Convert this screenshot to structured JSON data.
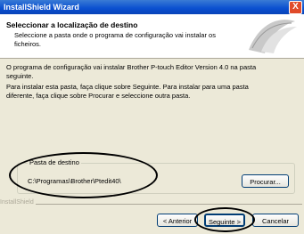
{
  "window": {
    "title": "InstallShield Wizard",
    "close_glyph": "X"
  },
  "header": {
    "title": "Seleccionar a localização de destino",
    "subtitle": "Seleccione a pasta onde o programa de configuração vai instalar os ficheiros."
  },
  "body": {
    "paragraph1": "O programa de configuração vai instalar Brother P-touch Editor Version 4.0 na pasta seguinte.",
    "paragraph2": "Para instalar esta pasta, faça clique sobre Seguinte. Para instalar para uma pasta diferente, faça clique sobre Procurar e seleccione outra pasta."
  },
  "destination": {
    "label": "Pasta de destino",
    "path": "C:\\Programas\\Brother\\Ptedit40\\",
    "browse_label": "Procurar..."
  },
  "footer": {
    "brand": "InstallShield",
    "back_label": "< Anterior",
    "next_label": "Seguinte >",
    "cancel_label": "Cancelar"
  },
  "colors": {
    "titlebar": "#0a4fd0",
    "dialog": "#ece9d8",
    "annotation": "#000000"
  },
  "icons": {
    "close": "close-icon",
    "logo": "installshield-logo-icon"
  }
}
